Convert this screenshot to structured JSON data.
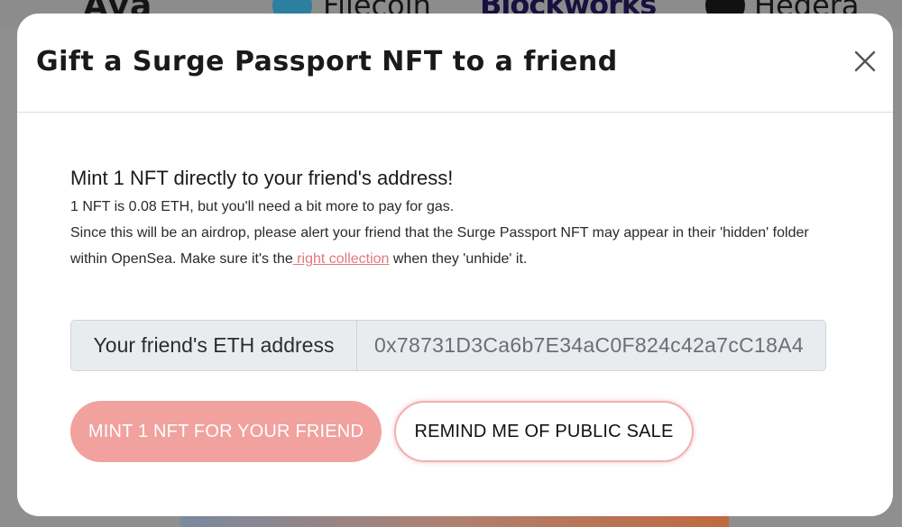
{
  "background": {
    "logos": [
      "Ava",
      "Filecoin",
      "Blockworks",
      "Hedera"
    ]
  },
  "modal": {
    "title": "Gift a Surge Passport NFT to a friend",
    "close_icon": "close-icon",
    "heading": "Mint 1 NFT directly to your friend's address!",
    "line_price": "1 NFT is 0.08 ETH, but you'll need a bit more to pay for gas.",
    "line_airdrop_a": "Since this will be an airdrop, please alert your friend that the Surge Passport NFT may appear in their 'hidden' folder within OpenSea. Make sure it's the",
    "link_text": " right collection",
    "line_airdrop_b": " when they 'unhide' it.",
    "address_label": "Your friend's ETH address",
    "address_value": "0x78731D3Ca6b7E34aC0F824c42a7cC18A4",
    "mint_button": "MINT 1 NFT FOR YOUR FRIEND",
    "remind_button": "REMIND ME OF PUBLIC SALE"
  },
  "colors": {
    "accent": "#f1a19e",
    "link": "#e0787a",
    "input_bg": "#e9ecef"
  }
}
